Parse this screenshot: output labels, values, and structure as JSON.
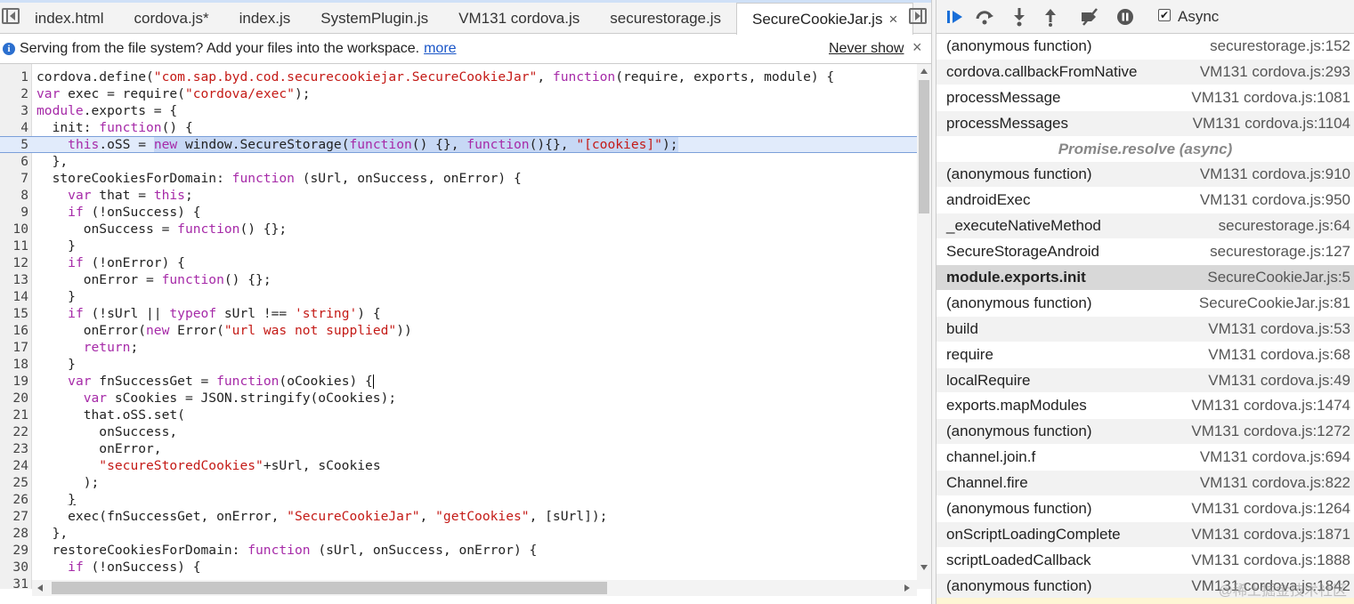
{
  "tabs": [
    {
      "label": "index.html"
    },
    {
      "label": "cordova.js*"
    },
    {
      "label": "index.js"
    },
    {
      "label": "SystemPlugin.js"
    },
    {
      "label": "VM131 cordova.js"
    },
    {
      "label": "securestorage.js"
    },
    {
      "label": "SecureCookieJar.js",
      "active": true
    }
  ],
  "infobar": {
    "message": "Serving from the file system? Add your files into the workspace.",
    "link": "more",
    "never_show": "Never show",
    "close": "×"
  },
  "editor": {
    "highlighted_line": 5,
    "lines": [
      {
        "n": "1",
        "html": "cordova.define(<span class=\"str\">\"com.sap.byd.cod.securecookiejar.SecureCookieJar\"</span>, <span class=\"kw\">function</span>(require, exports, module) {"
      },
      {
        "n": "2",
        "html": "<span class=\"kw\">var</span> exec = require(<span class=\"str\">\"cordova/exec\"</span>);"
      },
      {
        "n": "3",
        "html": "<span class=\"kw\">module</span>.exports = {"
      },
      {
        "n": "4",
        "html": "  init: <span class=\"kw\">function</span>() {"
      },
      {
        "n": "5",
        "html": "    <span class=\"kw\">this</span>.oSS = <span class=\"sel\"><span class=\"kw\">new</span> window.SecureStorage(<span class=\"kw\">function</span>() {}, <span class=\"kw\">function</span>(){}, <span class=\"str\">\"[cookies]\"</span>);</span>"
      },
      {
        "n": "6",
        "html": "  },"
      },
      {
        "n": "7",
        "html": "  storeCookiesForDomain: <span class=\"kw\">function</span> (sUrl, onSuccess, onError) {"
      },
      {
        "n": "8",
        "html": "    <span class=\"kw\">var</span> that = <span class=\"kw\">this</span>;"
      },
      {
        "n": "9",
        "html": "    <span class=\"kw\">if</span> (!onSuccess) {"
      },
      {
        "n": "10",
        "html": "      onSuccess = <span class=\"kw\">function</span>() {};"
      },
      {
        "n": "11",
        "html": "    }"
      },
      {
        "n": "12",
        "html": "    <span class=\"kw\">if</span> (!onError) {"
      },
      {
        "n": "13",
        "html": "      onError = <span class=\"kw\">function</span>() {};"
      },
      {
        "n": "14",
        "html": "    }"
      },
      {
        "n": "15",
        "html": "    <span class=\"kw\">if</span> (!sUrl || <span class=\"kw\">typeof</span> sUrl !== <span class=\"str\">'string'</span>) {"
      },
      {
        "n": "16",
        "html": "      onError(<span class=\"kw\">new</span> Error(<span class=\"str\">\"url was not supplied\"</span>))"
      },
      {
        "n": "17",
        "html": "      <span class=\"kw\">return</span>;"
      },
      {
        "n": "18",
        "html": "    }"
      },
      {
        "n": "19",
        "html": "    <span class=\"kw\">var</span> fnSuccessGet = <span class=\"kw\">function</span>(oCookies) {<span class=\"cursor\"></span>"
      },
      {
        "n": "20",
        "html": "      <span class=\"kw\">var</span> sCookies = JSON.stringify(oCookies);"
      },
      {
        "n": "21",
        "html": "      that.oSS.set("
      },
      {
        "n": "22",
        "html": "        onSuccess,"
      },
      {
        "n": "23",
        "html": "        onError,"
      },
      {
        "n": "24",
        "html": "        <span class=\"str\">\"secureStoredCookies\"</span>+sUrl, sCookies"
      },
      {
        "n": "25",
        "html": "      );"
      },
      {
        "n": "26",
        "html": "    <u>}</u>"
      },
      {
        "n": "27",
        "html": "    exec(fnSuccessGet, onError, <span class=\"str\">\"SecureCookieJar\"</span>, <span class=\"str\">\"getCookies\"</span>, [sUrl]);"
      },
      {
        "n": "28",
        "html": "  },"
      },
      {
        "n": "29",
        "html": "  restoreCookiesForDomain: <span class=\"kw\">function</span> (sUrl, onSuccess, onError) {"
      },
      {
        "n": "30",
        "html": "    <span class=\"kw\">if</span> (!onSuccess) {"
      },
      {
        "n": "31",
        "html": ""
      }
    ]
  },
  "toolbar": {
    "async_label": "Async",
    "async_checked": true,
    "buttons": [
      "resume-icon",
      "step-over-icon",
      "step-into-icon",
      "step-out-icon",
      "deactivate-breakpoints-icon",
      "pause-on-exceptions-icon"
    ]
  },
  "callstack": [
    {
      "fn": "(anonymous function)",
      "loc": "securestorage.js:152"
    },
    {
      "fn": "cordova.callbackFromNative",
      "loc": "VM131 cordova.js:293"
    },
    {
      "fn": "processMessage",
      "loc": "VM131 cordova.js:1081"
    },
    {
      "fn": "processMessages",
      "loc": "VM131 cordova.js:1104"
    },
    {
      "fn": "Promise.resolve (async)",
      "async": true
    },
    {
      "fn": "(anonymous function)",
      "loc": "VM131 cordova.js:910"
    },
    {
      "fn": "androidExec",
      "loc": "VM131 cordova.js:950"
    },
    {
      "fn": "_executeNativeMethod",
      "loc": "securestorage.js:64"
    },
    {
      "fn": "SecureStorageAndroid",
      "loc": "securestorage.js:127"
    },
    {
      "fn": "module.exports.init",
      "loc": "SecureCookieJar.js:5",
      "selected": true
    },
    {
      "fn": "(anonymous function)",
      "loc": "SecureCookieJar.js:81"
    },
    {
      "fn": "build",
      "loc": "VM131 cordova.js:53"
    },
    {
      "fn": "require",
      "loc": "VM131 cordova.js:68"
    },
    {
      "fn": "localRequire",
      "loc": "VM131 cordova.js:49"
    },
    {
      "fn": "exports.mapModules",
      "loc": "VM131 cordova.js:1474"
    },
    {
      "fn": "(anonymous function)",
      "loc": "VM131 cordova.js:1272"
    },
    {
      "fn": "channel.join.f",
      "loc": "VM131 cordova.js:694"
    },
    {
      "fn": "Channel.fire",
      "loc": "VM131 cordova.js:822"
    },
    {
      "fn": "(anonymous function)",
      "loc": "VM131 cordova.js:1264"
    },
    {
      "fn": "onScriptLoadingComplete",
      "loc": "VM131 cordova.js:1871"
    },
    {
      "fn": "scriptLoadedCallback",
      "loc": "VM131 cordova.js:1888"
    },
    {
      "fn": "(anonymous function)",
      "loc": "VM131 cordova.js:1842"
    }
  ],
  "watermark": "@稀土掘金技术社区",
  "colors": {
    "accent": "#1a56c8",
    "keyword": "#a62aa8",
    "string": "#c41a16",
    "selection": "#c7d8f5"
  }
}
